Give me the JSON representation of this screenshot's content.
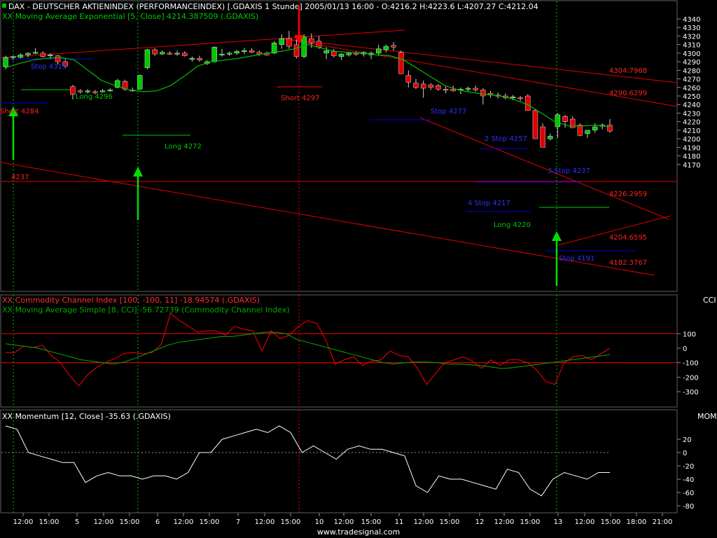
{
  "header": {
    "main_line1": "DAX  - DEUTSCHER AKTIENINDEX (PERFORMANCEINDEX) [.GDAXIS  1 Stunde] 2005/01/13 16:00 - O:4216.2 H:4223.6 L:4207.27 C:4212.04",
    "main_line2": "XX Moving Average Exponential [5, Close] 4214.387509 (.GDAXIS)",
    "cci_line1": "XX Commodity Channel Index [100, -100, 11] -18.94574 (.GDAXIS)",
    "cci_line2": "XX Moving Average Simple [8, CCI] -56.72739 (Commodity Channel Index)",
    "mom_line1": "XX Momentum [12, Close] -35.63 (.GDAXIS)"
  },
  "footer": {
    "credit": "www.tradesignal.com"
  },
  "colors": {
    "bg": "#000000",
    "grid": "#808080",
    "up": "#00c800",
    "down": "#e00000",
    "trend": "#e00000",
    "ema": "#00c000",
    "stop": "#0000e0",
    "cci": "#ff0000",
    "cci_ma": "#00aa00",
    "momentum": "#ffffff",
    "arrow_up": "#00e000",
    "arrow_down": "#ff0000"
  },
  "chart_data": [
    {
      "type": "candlestick",
      "panel": "price",
      "ylim": [
        4165,
        4350
      ],
      "y_ticks": [
        "4170",
        "4180",
        "4190",
        "4200",
        "4210",
        "4220",
        "4230",
        "4240",
        "4250",
        "4260",
        "4270",
        "4280",
        "4290",
        "4300",
        "4310",
        "4320",
        "4330",
        "4340"
      ],
      "x_ticks": [
        "12:00",
        "15:00",
        "5",
        "12:00",
        "15:00",
        "6",
        "12:00",
        "15:00",
        "7",
        "12:00",
        "15:00",
        "10",
        "12:00",
        "15:00",
        "11",
        "12:00",
        "15:00",
        "12",
        "12:00",
        "15:00",
        "13",
        "12:00",
        "15:00",
        "18:00",
        "21:00"
      ],
      "candles": [
        [
          4284,
          4297,
          4281,
          4295
        ],
        [
          4295,
          4297,
          4292,
          4296
        ],
        [
          4295,
          4300,
          4294,
          4298
        ],
        [
          4298,
          4301,
          4295,
          4300
        ],
        [
          4300,
          4306,
          4299,
          4301
        ],
        [
          4300,
          4302,
          4295,
          4296
        ],
        [
          4297,
          4300,
          4293,
          4298
        ],
        [
          4297,
          4298,
          4287,
          4290
        ],
        [
          4290,
          4293,
          4283,
          4285
        ],
        [
          4261,
          4263,
          4246,
          4252
        ],
        [
          4256,
          4258,
          4253,
          4255
        ],
        [
          4255,
          4258,
          4253,
          4256
        ],
        [
          4255,
          4257,
          4252,
          4254
        ],
        [
          4255,
          4258,
          4254,
          4256
        ],
        [
          4256,
          4259,
          4255,
          4257
        ],
        [
          4260,
          4270,
          4259,
          4268
        ],
        [
          4267,
          4269,
          4256,
          4258
        ],
        [
          4257,
          4260,
          4255,
          4256
        ],
        [
          4258,
          4275,
          4257,
          4274
        ],
        [
          4283,
          4305,
          4281,
          4304
        ],
        [
          4304,
          4306,
          4297,
          4299
        ],
        [
          4299,
          4303,
          4298,
          4301
        ],
        [
          4300,
          4302,
          4298,
          4299
        ],
        [
          4299,
          4303,
          4297,
          4300
        ],
        [
          4300,
          4302,
          4296,
          4297
        ],
        [
          4293,
          4296,
          4290,
          4294
        ],
        [
          4294,
          4297,
          4290,
          4292
        ],
        [
          4288,
          4292,
          4286,
          4290
        ],
        [
          4290,
          4308,
          4289,
          4307
        ],
        [
          4298,
          4305,
          4296,
          4299
        ],
        [
          4299,
          4302,
          4297,
          4300
        ],
        [
          4300,
          4304,
          4298,
          4302
        ],
        [
          4302,
          4306,
          4299,
          4303
        ],
        [
          4303,
          4306,
          4300,
          4301
        ],
        [
          4301,
          4303,
          4297,
          4299
        ],
        [
          4300,
          4302,
          4297,
          4298
        ],
        [
          4300,
          4314,
          4299,
          4312
        ],
        [
          4310,
          4322,
          4305,
          4317
        ],
        [
          4317,
          4326,
          4305,
          4308
        ],
        [
          4310,
          4320,
          4294,
          4296
        ],
        [
          4296,
          4322,
          4294,
          4319
        ],
        [
          4317,
          4323,
          4306,
          4312
        ],
        [
          4314,
          4320,
          4305,
          4307
        ],
        [
          4300,
          4307,
          4293,
          4303
        ],
        [
          4302,
          4305,
          4295,
          4297
        ],
        [
          4296,
          4300,
          4292,
          4299
        ],
        [
          4298,
          4301,
          4296,
          4300
        ],
        [
          4300,
          4302,
          4297,
          4299
        ],
        [
          4299,
          4302,
          4296,
          4301
        ],
        [
          4298,
          4302,
          4293,
          4300
        ],
        [
          4300,
          4310,
          4297,
          4305
        ],
        [
          4304,
          4310,
          4301,
          4308
        ],
        [
          4309,
          4313,
          4303,
          4307
        ],
        [
          4301,
          4303,
          4278,
          4276
        ],
        [
          4274,
          4280,
          4260,
          4266
        ],
        [
          4265,
          4270,
          4258,
          4260
        ],
        [
          4264,
          4268,
          4248,
          4259
        ],
        [
          4263,
          4265,
          4257,
          4260
        ],
        [
          4262,
          4264,
          4256,
          4258
        ],
        [
          4258,
          4262,
          4253,
          4257
        ],
        [
          4258,
          4262,
          4255,
          4256
        ],
        [
          4257,
          4260,
          4252,
          4258
        ],
        [
          4258,
          4261,
          4255,
          4259
        ],
        [
          4259,
          4262,
          4255,
          4257
        ],
        [
          4257,
          4259,
          4240,
          4250
        ],
        [
          4253,
          4256,
          4248,
          4251
        ],
        [
          4251,
          4254,
          4247,
          4250
        ],
        [
          4250,
          4253,
          4246,
          4248
        ],
        [
          4249,
          4251,
          4245,
          4249
        ],
        [
          4248,
          4250,
          4244,
          4247
        ],
        [
          4250,
          4252,
          4234,
          4233
        ],
        [
          4233,
          4235,
          4210,
          4200
        ],
        [
          4214,
          4218,
          4197,
          4190
        ],
        [
          4200,
          4206,
          4198,
          4203
        ],
        [
          4214,
          4230,
          4201,
          4228
        ],
        [
          4226,
          4228,
          4213,
          4220
        ],
        [
          4223,
          4226,
          4216,
          4213
        ],
        [
          4216,
          4218,
          4203,
          4204
        ],
        [
          4206,
          4210,
          4201,
          4210
        ],
        [
          4210,
          4218,
          4207,
          4214
        ],
        [
          4215,
          4218,
          4211,
          4216
        ],
        [
          4216,
          4223,
          4207,
          4209
        ]
      ],
      "ema": [
        4283,
        4288,
        4292,
        4294,
        4295,
        4292,
        4280,
        4268,
        4262,
        4257,
        4255,
        4256,
        4262,
        4273,
        4285,
        4290,
        4292,
        4294,
        4297,
        4300,
        4302,
        4305,
        4310,
        4306,
        4302,
        4301,
        4300,
        4298,
        4297,
        4292,
        4282,
        4272,
        4262,
        4257,
        4254,
        4252,
        4250,
        4246,
        4240,
        4230,
        4220,
        4215,
        4215,
        4216,
        4214
      ],
      "annotations": [
        "Stop 4315",
        "Long 4296",
        "Short 4284",
        "Long 4272",
        "4237",
        "Short 4297",
        "Stop 4277",
        "2 Stop 4257",
        "3 Stop 4237",
        "4 Stop 4217",
        "Long 4220",
        "Stop 4191",
        "4304.7968",
        "4290.6299",
        "4226.2959",
        "4204.6595",
        "4182.3767"
      ]
    },
    {
      "type": "line",
      "panel": "cci",
      "y_ticks": [
        "100",
        "0",
        "-100",
        "-200",
        "-300"
      ],
      "series": [
        {
          "name": "Commodity Channel Index",
          "values": [
            -30,
            -30,
            15,
            5,
            20,
            -50,
            -100,
            -190,
            -260,
            -180,
            -130,
            -95,
            -70,
            -35,
            -30,
            -40,
            -30,
            25,
            240,
            190,
            150,
            110,
            120,
            120,
            90,
            150,
            130,
            120,
            -20,
            120,
            65,
            90,
            150,
            190,
            170,
            50,
            -110,
            -80,
            -60,
            -120,
            -90,
            -80,
            -20,
            -50,
            -60,
            -140,
            -250,
            -170,
            -100,
            -80,
            -60,
            -90,
            -140,
            -80,
            -120,
            -80,
            -80,
            -100,
            -150,
            -230,
            -250,
            -100,
            -60,
            -50,
            -80,
            -40,
            0
          ]
        },
        {
          "name": "Moving Average Simple",
          "values": [
            30,
            20,
            10,
            0,
            -20,
            -40,
            -60,
            -80,
            -90,
            -100,
            -110,
            -95,
            -70,
            -40,
            -10,
            20,
            40,
            50,
            60,
            70,
            80,
            80,
            90,
            100,
            110,
            110,
            100,
            60,
            40,
            20,
            0,
            -20,
            -40,
            -60,
            -80,
            -100,
            -110,
            -100,
            -95,
            -95,
            -100,
            -110,
            -110,
            -115,
            -120,
            -130,
            -140,
            -135,
            -125,
            -115,
            -105,
            -95,
            -85,
            -75,
            -65,
            -55,
            -45
          ]
        }
      ]
    },
    {
      "type": "line",
      "panel": "momentum",
      "y_ticks": [
        "20",
        "0",
        "-20",
        "-40",
        "-60",
        "-80"
      ],
      "series": [
        {
          "name": "Momentum",
          "values": [
            40,
            35,
            0,
            -5,
            -10,
            -15,
            -15,
            -45,
            -35,
            -30,
            -35,
            -35,
            -40,
            -35,
            -35,
            -40,
            -30,
            0,
            0,
            20,
            25,
            30,
            35,
            30,
            40,
            30,
            0,
            10,
            0,
            -10,
            5,
            10,
            5,
            5,
            0,
            -5,
            -50,
            -60,
            -35,
            -40,
            -40,
            -45,
            -50,
            -55,
            -25,
            -30,
            -55,
            -65,
            -40,
            -30,
            -35,
            -40,
            -30,
            -30
          ]
        }
      ]
    }
  ]
}
